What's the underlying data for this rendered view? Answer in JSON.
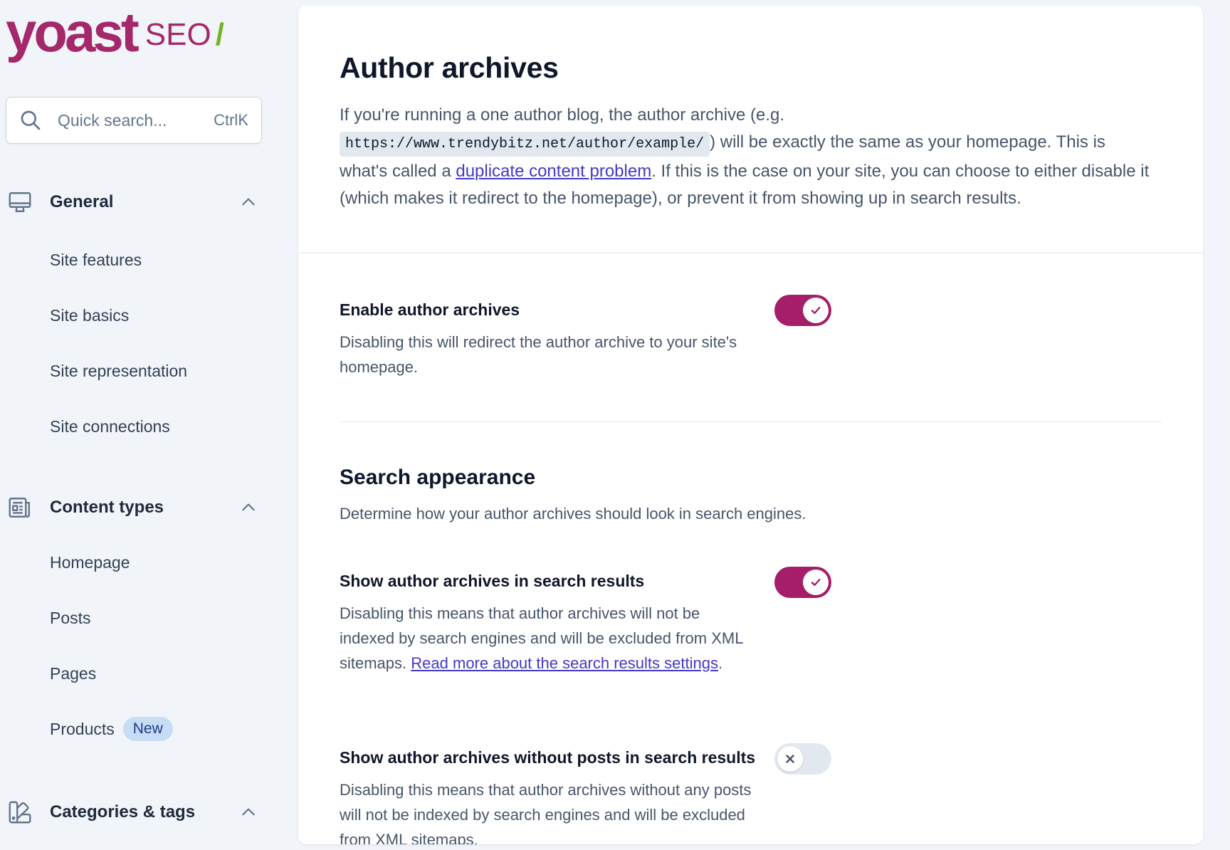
{
  "brand": {
    "name": "yoast",
    "product": "SEO",
    "slash": "/"
  },
  "search": {
    "placeholder": "Quick search...",
    "shortcut": "CtrlK"
  },
  "sidebar": {
    "groups": [
      {
        "label": "General",
        "icon": "desktop-icon",
        "items": [
          {
            "label": "Site features"
          },
          {
            "label": "Site basics"
          },
          {
            "label": "Site representation"
          },
          {
            "label": "Site connections"
          }
        ]
      },
      {
        "label": "Content types",
        "icon": "newspaper-icon",
        "items": [
          {
            "label": "Homepage"
          },
          {
            "label": "Posts"
          },
          {
            "label": "Pages"
          },
          {
            "label": "Products",
            "badge": "New"
          }
        ]
      },
      {
        "label": "Categories & tags",
        "icon": "color-swatch-icon",
        "items": []
      }
    ]
  },
  "main": {
    "title": "Author archives",
    "intro": {
      "part1": "If you're running a one author blog, the author archive (e.g.",
      "code": "https://www.trendybitz.net/author/example/",
      "part2": ") will be exactly the same as your homepage. This is what's called a",
      "link": "duplicate content problem",
      "part3": ". If this is the case on your site, you can choose to either disable it (which makes it redirect to the homepage), or prevent it from showing up in search results."
    },
    "enable": {
      "title": "Enable author archives",
      "desc": "Disabling this will redirect the author archive to your site's homepage.",
      "on": true
    },
    "search_appearance": {
      "title": "Search appearance",
      "desc": "Determine how your author archives should look in search engines."
    },
    "show_in_results": {
      "title": "Show author archives in search results",
      "desc": "Disabling this means that author archives will not be indexed by search engines and will be excluded from XML sitemaps.",
      "link": "Read more about the search results settings",
      "after_link": ".",
      "on": true
    },
    "show_without_posts": {
      "title": "Show author archives without posts in search results",
      "desc": "Disabling this means that author archives without any posts will not be indexed by search engines and will be excluded from XML sitemaps.",
      "on": false
    }
  },
  "colors": {
    "brand": "#a4286a",
    "toggle_on": "#a61e69",
    "slash": "#77b227",
    "link": "#4338ca"
  }
}
